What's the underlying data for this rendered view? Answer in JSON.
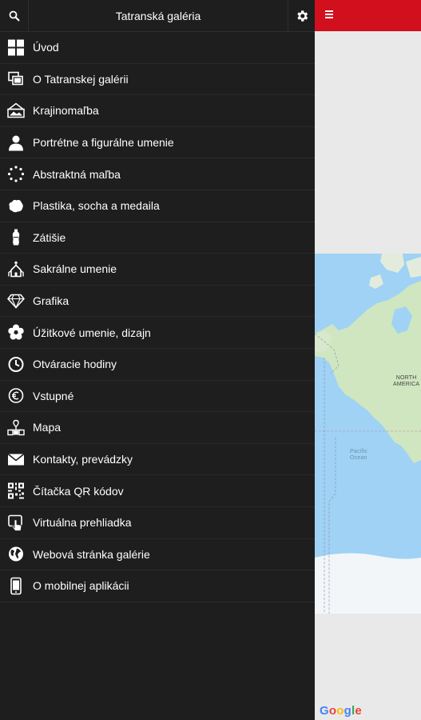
{
  "header": {
    "title": "Tatranská galéria",
    "search_icon": "search-icon",
    "settings_icon": "gear-icon"
  },
  "menu": {
    "items": [
      {
        "label": "Úvod",
        "icon": "grid-icon"
      },
      {
        "label": "O Tatranskej galérii",
        "icon": "gallery-icon"
      },
      {
        "label": "Krajinomaľba",
        "icon": "landscape-icon"
      },
      {
        "label": "Portrétne a figurálne umenie",
        "icon": "person-icon"
      },
      {
        "label": "Abstraktná maľba",
        "icon": "dotted-circle-icon"
      },
      {
        "label": "Plastika, socha a medaila",
        "icon": "sculpture-icon"
      },
      {
        "label": "Zátišie",
        "icon": "vase-icon"
      },
      {
        "label": "Sakrálne umenie",
        "icon": "church-icon"
      },
      {
        "label": "Grafika",
        "icon": "diamond-icon"
      },
      {
        "label": "Úžitkové umenie, dizajn",
        "icon": "flower-icon"
      },
      {
        "label": "Otváracie hodiny",
        "icon": "clock-icon"
      },
      {
        "label": "Vstupné",
        "icon": "euro-icon"
      },
      {
        "label": "Mapa",
        "icon": "map-route-icon"
      },
      {
        "label": "Kontakty, prevádzky",
        "icon": "envelope-icon"
      },
      {
        "label": "Čítačka QR kódov",
        "icon": "qr-code-icon"
      },
      {
        "label": "Virtuálna prehliadka",
        "icon": "touch-screen-icon"
      },
      {
        "label": "Webová stránka galérie",
        "icon": "globe-icon"
      },
      {
        "label": "O mobilnej aplikácii",
        "icon": "phone-icon"
      }
    ]
  },
  "map": {
    "labels": {
      "north_america": "NORTH\nAMERICA",
      "pacific": "Pacific\nOcean"
    },
    "attribution": "Google"
  },
  "colors": {
    "drawer_bg": "#1e1e1e",
    "accent_red": "#d20f1d",
    "ocean": "#9fd2f5",
    "land": "#cfe6c0"
  }
}
